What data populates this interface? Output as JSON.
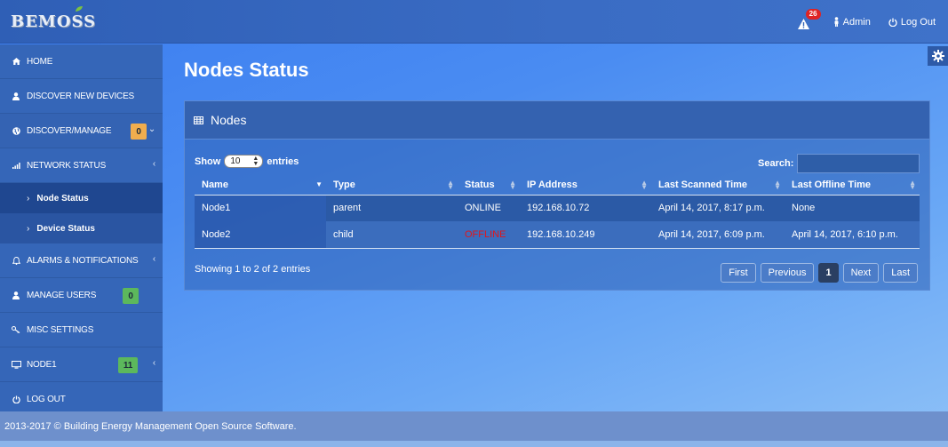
{
  "brand": {
    "logo_text": "BEMOSS"
  },
  "topbar": {
    "alert_count": "26",
    "admin_label": "Admin",
    "logout_label": "Log Out"
  },
  "sidebar": {
    "items": [
      {
        "label": "HOME",
        "icon": "home-icon"
      },
      {
        "label": "DISCOVER NEW DEVICES",
        "icon": "user-icon"
      },
      {
        "label": "DISCOVER/MANAGE",
        "icon": "globe-icon",
        "badge": "0",
        "badge_color": "#f0ad4e"
      },
      {
        "label": "NETWORK STATUS",
        "icon": "signal-icon"
      },
      {
        "label": "ALARMS & NOTIFICATIONS",
        "icon": "bell-icon"
      },
      {
        "label": "MANAGE USERS",
        "icon": "user-icon",
        "badge": "0",
        "badge_color": "#5cb85c"
      },
      {
        "label": "MISC SETTINGS",
        "icon": "key-icon"
      },
      {
        "label": "NODE1",
        "icon": "monitor-icon",
        "badge": "11",
        "badge_color": "#5cb85c"
      },
      {
        "label": "LOG OUT",
        "icon": "power-icon"
      }
    ],
    "subitems": [
      {
        "label": "Node Status"
      },
      {
        "label": "Device Status"
      }
    ]
  },
  "main": {
    "title": "Nodes Status",
    "panel_title": "Nodes",
    "show_label": "Show",
    "entries_value": "10",
    "entries_label": "entries",
    "search_label": "Search:",
    "columns": [
      "Name",
      "Type",
      "Status",
      "IP Address",
      "Last Scanned Time",
      "Last Offline Time"
    ],
    "rows": [
      [
        "Node1",
        "parent",
        "ONLINE",
        "192.168.10.72",
        "April 14, 2017, 8:17 p.m.",
        "None"
      ],
      [
        "Node2",
        "child",
        "OFFLINE",
        "192.168.10.249",
        "April 14, 2017, 6:09 p.m.",
        "April 14, 2017, 6:10 p.m."
      ]
    ],
    "info": "Showing 1 to 2 of 2 entries",
    "pager": {
      "first": "First",
      "previous": "Previous",
      "current": "1",
      "next": "Next",
      "last": "Last"
    }
  },
  "footer": {
    "text": "2013-2017 © Building Energy Management Open Source Software."
  },
  "colors": {
    "offline": "#e0161c",
    "alert_badge": "#e02323"
  }
}
